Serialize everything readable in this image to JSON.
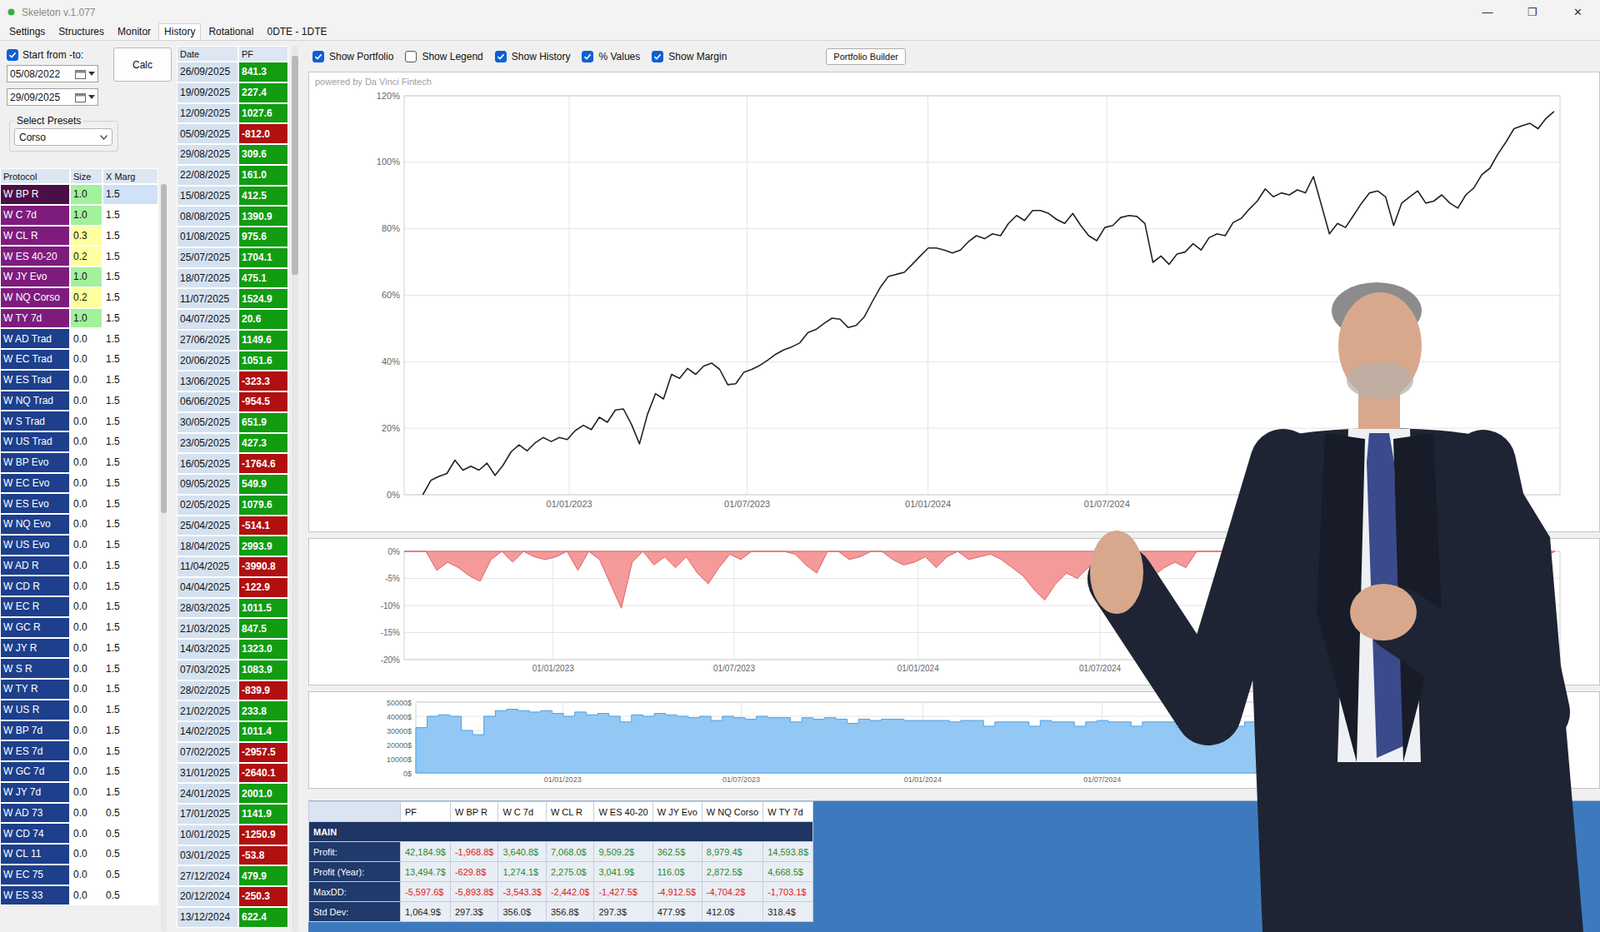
{
  "window": {
    "title": "Skeleton v.1.077",
    "controls": [
      "—",
      "❐",
      "✕"
    ]
  },
  "tabs": [
    {
      "label": "Settings",
      "selected": false
    },
    {
      "label": "Structures",
      "selected": false
    },
    {
      "label": "Monitor",
      "selected": false
    },
    {
      "label": "History",
      "selected": true
    },
    {
      "label": "Rotational",
      "selected": false
    },
    {
      "label": "0DTE - 1DTE",
      "selected": false
    }
  ],
  "range": {
    "checkbox": {
      "label": "Start from -to:",
      "checked": true
    },
    "from": "05/08/2022",
    "to": "29/09/2025",
    "calc": "Calc"
  },
  "presets": {
    "label": "Select Presets",
    "value": "Corso"
  },
  "protocols": {
    "columns": [
      "Protocol",
      "Size",
      "X Marg"
    ],
    "rows": [
      {
        "name": "W BP R",
        "size": "1.0",
        "margin": "1.5",
        "selected": true,
        "color": "#4b0f47",
        "size_color": "#a2f29c"
      },
      {
        "name": "W C 7d",
        "size": "1.0",
        "margin": "1.5",
        "selected": false,
        "color": "#7e1c7e",
        "size_color": "#a2f29c"
      },
      {
        "name": "W CL R",
        "size": "0.3",
        "margin": "1.5",
        "selected": false,
        "color": "#7e1c7e",
        "size_color": "#ffff9e"
      },
      {
        "name": "W ES 40-20",
        "size": "0.2",
        "margin": "1.5",
        "selected": false,
        "color": "#7e1c7e",
        "size_color": "#ffff9e"
      },
      {
        "name": "W JY Evo",
        "size": "1.0",
        "margin": "1.5",
        "selected": false,
        "color": "#7e1c7e",
        "size_color": "#a2f29c"
      },
      {
        "name": "W NQ Corso",
        "size": "0.2",
        "margin": "1.5",
        "selected": false,
        "color": "#7e1c7e",
        "size_color": "#ffff9e"
      },
      {
        "name": "W TY 7d",
        "size": "1.0",
        "margin": "1.5",
        "selected": false,
        "color": "#7e1c7e",
        "size_color": "#a2f29c"
      },
      {
        "name": "W AD Trad",
        "size": "0.0",
        "margin": "1.5",
        "selected": false,
        "color": "#1d3f8c",
        "size_color": "#ffffff"
      },
      {
        "name": "W EC Trad",
        "size": "0.0",
        "margin": "1.5",
        "selected": false,
        "color": "#1d3f8c",
        "size_color": "#ffffff"
      },
      {
        "name": "W ES Trad",
        "size": "0.0",
        "margin": "1.5",
        "selected": false,
        "color": "#1d3f8c",
        "size_color": "#ffffff"
      },
      {
        "name": "W NQ Trad",
        "size": "0.0",
        "margin": "1.5",
        "selected": false,
        "color": "#1d3f8c",
        "size_color": "#ffffff"
      },
      {
        "name": "W S Trad",
        "size": "0.0",
        "margin": "1.5",
        "selected": false,
        "color": "#1d3f8c",
        "size_color": "#ffffff"
      },
      {
        "name": "W US Trad",
        "size": "0.0",
        "margin": "1.5",
        "selected": false,
        "color": "#1d3f8c",
        "size_color": "#ffffff"
      },
      {
        "name": "W BP Evo",
        "size": "0.0",
        "margin": "1.5",
        "selected": false,
        "color": "#1d3f8c",
        "size_color": "#ffffff"
      },
      {
        "name": "W EC Evo",
        "size": "0.0",
        "margin": "1.5",
        "selected": false,
        "color": "#1d3f8c",
        "size_color": "#ffffff"
      },
      {
        "name": "W ES Evo",
        "size": "0.0",
        "margin": "1.5",
        "selected": false,
        "color": "#1d3f8c",
        "size_color": "#ffffff"
      },
      {
        "name": "W NQ Evo",
        "size": "0.0",
        "margin": "1.5",
        "selected": false,
        "color": "#1d3f8c",
        "size_color": "#ffffff"
      },
      {
        "name": "W US Evo",
        "size": "0.0",
        "margin": "1.5",
        "selected": false,
        "color": "#1d3f8c",
        "size_color": "#ffffff"
      },
      {
        "name": "W AD R",
        "size": "0.0",
        "margin": "1.5",
        "selected": false,
        "color": "#1d3f8c",
        "size_color": "#ffffff"
      },
      {
        "name": "W CD R",
        "size": "0.0",
        "margin": "1.5",
        "selected": false,
        "color": "#1d3f8c",
        "size_color": "#ffffff"
      },
      {
        "name": "W EC R",
        "size": "0.0",
        "margin": "1.5",
        "selected": false,
        "color": "#1d3f8c",
        "size_color": "#ffffff"
      },
      {
        "name": "W GC R",
        "size": "0.0",
        "margin": "1.5",
        "selected": false,
        "color": "#1d3f8c",
        "size_color": "#ffffff"
      },
      {
        "name": "W JY R",
        "size": "0.0",
        "margin": "1.5",
        "selected": false,
        "color": "#1d3f8c",
        "size_color": "#ffffff"
      },
      {
        "name": "W S R",
        "size": "0.0",
        "margin": "1.5",
        "selected": false,
        "color": "#1d3f8c",
        "size_color": "#ffffff"
      },
      {
        "name": "W TY R",
        "size": "0.0",
        "margin": "1.5",
        "selected": false,
        "color": "#1d3f8c",
        "size_color": "#ffffff"
      },
      {
        "name": "W US R",
        "size": "0.0",
        "margin": "1.5",
        "selected": false,
        "color": "#1d3f8c",
        "size_color": "#ffffff"
      },
      {
        "name": "W BP 7d",
        "size": "0.0",
        "margin": "1.5",
        "selected": false,
        "color": "#1d3f8c",
        "size_color": "#ffffff"
      },
      {
        "name": "W ES 7d",
        "size": "0.0",
        "margin": "1.5",
        "selected": false,
        "color": "#1d3f8c",
        "size_color": "#ffffff"
      },
      {
        "name": "W GC 7d",
        "size": "0.0",
        "margin": "1.5",
        "selected": false,
        "color": "#1d3f8c",
        "size_color": "#ffffff"
      },
      {
        "name": "W JY 7d",
        "size": "0.0",
        "margin": "1.5",
        "selected": false,
        "color": "#1d3f8c",
        "size_color": "#ffffff"
      },
      {
        "name": "W AD 73",
        "size": "0.0",
        "margin": "0.5",
        "selected": false,
        "color": "#1d3f8c",
        "size_color": "#ffffff"
      },
      {
        "name": "W CD 74",
        "size": "0.0",
        "margin": "0.5",
        "selected": false,
        "color": "#1d3f8c",
        "size_color": "#ffffff"
      },
      {
        "name": "W CL 11",
        "size": "0.0",
        "margin": "0.5",
        "selected": false,
        "color": "#1d3f8c",
        "size_color": "#ffffff"
      },
      {
        "name": "W EC 75",
        "size": "0.0",
        "margin": "0.5",
        "selected": false,
        "color": "#1d3f8c",
        "size_color": "#ffffff"
      },
      {
        "name": "W ES 33",
        "size": "0.0",
        "margin": "0.5",
        "selected": false,
        "color": "#1d3f8c",
        "size_color": "#ffffff"
      }
    ]
  },
  "history": {
    "columns": [
      "Date",
      "PF"
    ],
    "rows": [
      {
        "date": "26/09/2025",
        "pf": "841.3",
        "color": "#129c12"
      },
      {
        "date": "19/09/2025",
        "pf": "227.4",
        "color": "#129c12"
      },
      {
        "date": "12/09/2025",
        "pf": "1027.6",
        "color": "#129c12"
      },
      {
        "date": "05/09/2025",
        "pf": "-812.0",
        "color": "#b01010"
      },
      {
        "date": "29/08/2025",
        "pf": "309.6",
        "color": "#129c12"
      },
      {
        "date": "22/08/2025",
        "pf": "161.0",
        "color": "#129c12"
      },
      {
        "date": "15/08/2025",
        "pf": "412.5",
        "color": "#129c12"
      },
      {
        "date": "08/08/2025",
        "pf": "1390.9",
        "color": "#129c12"
      },
      {
        "date": "01/08/2025",
        "pf": "975.6",
        "color": "#129c12"
      },
      {
        "date": "25/07/2025",
        "pf": "1704.1",
        "color": "#129c12"
      },
      {
        "date": "18/07/2025",
        "pf": "475.1",
        "color": "#129c12"
      },
      {
        "date": "11/07/2025",
        "pf": "1524.9",
        "color": "#129c12"
      },
      {
        "date": "04/07/2025",
        "pf": "20.6",
        "color": "#129c12"
      },
      {
        "date": "27/06/2025",
        "pf": "1149.6",
        "color": "#129c12"
      },
      {
        "date": "20/06/2025",
        "pf": "1051.6",
        "color": "#129c12"
      },
      {
        "date": "13/06/2025",
        "pf": "-323.3",
        "color": "#b01010"
      },
      {
        "date": "06/06/2025",
        "pf": "-954.5",
        "color": "#b01010"
      },
      {
        "date": "30/05/2025",
        "pf": "651.9",
        "color": "#129c12"
      },
      {
        "date": "23/05/2025",
        "pf": "427.3",
        "color": "#129c12"
      },
      {
        "date": "16/05/2025",
        "pf": "-1764.6",
        "color": "#b01010"
      },
      {
        "date": "09/05/2025",
        "pf": "549.9",
        "color": "#129c12"
      },
      {
        "date": "02/05/2025",
        "pf": "1079.6",
        "color": "#129c12"
      },
      {
        "date": "25/04/2025",
        "pf": "-514.1",
        "color": "#b01010"
      },
      {
        "date": "18/04/2025",
        "pf": "2993.9",
        "color": "#129c12"
      },
      {
        "date": "11/04/2025",
        "pf": "-3990.8",
        "color": "#b01010"
      },
      {
        "date": "04/04/2025",
        "pf": "-122.9",
        "color": "#b01010"
      },
      {
        "date": "28/03/2025",
        "pf": "1011.5",
        "color": "#129c12"
      },
      {
        "date": "21/03/2025",
        "pf": "847.5",
        "color": "#129c12"
      },
      {
        "date": "14/03/2025",
        "pf": "1323.0",
        "color": "#129c12"
      },
      {
        "date": "07/03/2025",
        "pf": "1083.9",
        "color": "#129c12"
      },
      {
        "date": "28/02/2025",
        "pf": "-839.9",
        "color": "#b01010"
      },
      {
        "date": "21/02/2025",
        "pf": "233.8",
        "color": "#129c12"
      },
      {
        "date": "14/02/2025",
        "pf": "1011.4",
        "color": "#129c12"
      },
      {
        "date": "07/02/2025",
        "pf": "-2957.5",
        "color": "#b01010"
      },
      {
        "date": "31/01/2025",
        "pf": "-2640.1",
        "color": "#b01010"
      },
      {
        "date": "24/01/2025",
        "pf": "2001.0",
        "color": "#129c12"
      },
      {
        "date": "17/01/2025",
        "pf": "1141.9",
        "color": "#129c12"
      },
      {
        "date": "10/01/2025",
        "pf": "-1250.9",
        "color": "#b01010"
      },
      {
        "date": "03/01/2025",
        "pf": "-53.8",
        "color": "#b01010"
      },
      {
        "date": "27/12/2024",
        "pf": "479.9",
        "color": "#129c12"
      },
      {
        "date": "20/12/2024",
        "pf": "-250.3",
        "color": "#b01010"
      },
      {
        "date": "13/12/2024",
        "pf": "622.4",
        "color": "#129c12"
      }
    ]
  },
  "options": [
    {
      "label": "Show Portfolio",
      "checked": true
    },
    {
      "label": "Show Legend",
      "checked": false
    },
    {
      "label": "Show History",
      "checked": true
    },
    {
      "label": "% Values",
      "checked": true
    },
    {
      "label": "Show Margin",
      "checked": true
    }
  ],
  "builder_button": "Portfolio Builder",
  "equity_chart": {
    "watermark": "powered by Da Vinci Fintech",
    "y_ticks": [
      "120%",
      "100%",
      "80%",
      "60%",
      "40%",
      "20%",
      "0%"
    ],
    "x_ticks": [
      "01/01/2023",
      "01/07/2023",
      "01/01/2024",
      "01/07/2024"
    ],
    "values": [
      0,
      4.3,
      5.5,
      6.4,
      10.4,
      7.4,
      8.6,
      7.4,
      9.5,
      5.8,
      8.9,
      12.9,
      15,
      13.2,
      15.6,
      17.2,
      16,
      17.2,
      16.6,
      19.3,
      20.9,
      19.6,
      23.3,
      21.8,
      25.5,
      25.8,
      21.2,
      15.3,
      24.2,
      30.4,
      28.8,
      36.2,
      35,
      38,
      36.2,
      38.7,
      39.6,
      37.7,
      33.1,
      33.4,
      36.8,
      37.7,
      38.9,
      40.5,
      42.3,
      43.6,
      44.5,
      45.7,
      48.8,
      49.7,
      51.5,
      53.1,
      52.8,
      50.3,
      50.9,
      53.4,
      58,
      62.3,
      65.6,
      66.3,
      66.9,
      69.3,
      71.8,
      74.2,
      74.2,
      73.6,
      72.7,
      73.6,
      76.1,
      77.9,
      77,
      78.5,
      77.9,
      81.6,
      84,
      82.5,
      85.5,
      85.5,
      84.6,
      82.8,
      81.6,
      84.6,
      81,
      77.9,
      76.4,
      80.4,
      81,
      83.4,
      84,
      83.7,
      81.6,
      69.9,
      71.8,
      69.3,
      72.4,
      73,
      75.5,
      73.6,
      77.3,
      78.5,
      77.9,
      81.9,
      83.1,
      85.9,
      88.3,
      92,
      89.6,
      90.8,
      90.2,
      91.7,
      90.8,
      95.7,
      87.1,
      78.5,
      81.6,
      80.4,
      84,
      87.7,
      90.8,
      91.4,
      89.6,
      81,
      87.7,
      89.6,
      91.4,
      87.7,
      88.3,
      90.2,
      87.7,
      86.2,
      90.2,
      92.3,
      96.3,
      98.2,
      102.5,
      106.1,
      110.1,
      111,
      111.7,
      110.1,
      113.2,
      115.3
    ]
  },
  "drawdown_chart": {
    "y_ticks": [
      "0%",
      "-5%",
      "-10%",
      "-15%",
      "-20%"
    ],
    "x_ticks": [
      "01/01/2023",
      "01/07/2023",
      "01/01/2024",
      "01/07/2024"
    ],
    "values": [
      0,
      0,
      0,
      -3.5,
      -2,
      -3,
      -4.5,
      -5.5,
      -1.5,
      0,
      -2,
      0,
      -1,
      -1.5,
      -1,
      0,
      -3.5,
      0,
      -1.5,
      -6,
      -10.5,
      -2,
      0,
      -2.5,
      -1,
      -3,
      -1,
      -4,
      -6,
      -3,
      -0.5,
      -1.5,
      0,
      0,
      0,
      0,
      -0.5,
      -2.5,
      -4,
      0,
      0,
      -1.5,
      -1,
      0,
      0,
      -1.5,
      -2.5,
      -2,
      -1,
      -3,
      -1,
      0,
      -1.5,
      -1,
      -0.5,
      -1.5,
      -3,
      -4.5,
      -7,
      -9,
      -6,
      -4,
      -5,
      -3,
      -2,
      -7,
      -6,
      -5,
      -4,
      -4.5,
      -3,
      -2,
      -3,
      0,
      0,
      0,
      0,
      -1,
      0,
      0,
      -1.5,
      0,
      -1,
      0,
      -2,
      -7,
      -8,
      -6,
      -5,
      -3,
      -1,
      0,
      -6,
      -2,
      0,
      0,
      -1,
      0,
      -1.5,
      -1,
      0,
      0,
      0,
      0,
      0,
      -1,
      0
    ]
  },
  "margin_chart": {
    "y_ticks": [
      "50000$",
      "40000$",
      "30000$",
      "20000$",
      "10000$",
      "0$"
    ],
    "x_ticks": [
      "01/01/2023",
      "01/07/2023",
      "01/01/2024",
      "01/07/2024"
    ],
    "values": [
      32000,
      40000,
      41000,
      40000,
      30000,
      27000,
      40000,
      44000,
      45000,
      44000,
      43000,
      44000,
      42000,
      40000,
      43000,
      41000,
      42000,
      40000,
      36000,
      41000,
      40000,
      42000,
      41000,
      40000,
      39000,
      40000,
      37000,
      40000,
      39000,
      38000,
      40000,
      39000,
      39000,
      36000,
      39000,
      38000,
      39000,
      38000,
      35000,
      38000,
      37000,
      38000,
      38000,
      37000,
      37000,
      37000,
      37000,
      36000,
      37000,
      37000,
      33000,
      36000,
      36000,
      36000,
      33000,
      37000,
      36000,
      36000,
      33000,
      36000,
      37000,
      36000,
      36000,
      33000,
      36000,
      36000,
      36000,
      32000,
      36000,
      36000,
      36000,
      36000,
      33000,
      36000,
      36000,
      36000,
      36000,
      32000,
      36000,
      36000,
      36000,
      36000,
      36000,
      33000,
      36000,
      36000,
      36000,
      36000,
      33000,
      36000,
      36000,
      36000,
      36000,
      36000,
      36000,
      33000,
      36000,
      36000,
      36000,
      36000
    ]
  },
  "stats": {
    "columns": [
      "PF",
      "W BP R",
      "W C 7d",
      "W CL R",
      "W ES 40-20",
      "W JY Evo",
      "W NQ Corso",
      "W TY 7d"
    ],
    "section": "MAIN",
    "rows": [
      {
        "label": "Profit:",
        "cells": [
          {
            "text": "42,184.9$",
            "color": "#2a8a2a"
          },
          {
            "text": "-1,968.8$",
            "color": "#e02020"
          },
          {
            "text": "3,640.8$",
            "color": "#2a8a2a"
          },
          {
            "text": "7,068.0$",
            "color": "#2a8a2a"
          },
          {
            "text": "9,509.2$",
            "color": "#2a8a2a"
          },
          {
            "text": "362.5$",
            "color": "#2a8a2a"
          },
          {
            "text": "8,979.4$",
            "color": "#2a8a2a"
          },
          {
            "text": "14,593.8$",
            "color": "#2a8a2a"
          }
        ]
      },
      {
        "label": "Profit (Year):",
        "cells": [
          {
            "text": "13,494.7$",
            "color": "#2a8a2a"
          },
          {
            "text": "-629.8$",
            "color": "#e02020"
          },
          {
            "text": "1,274.1$",
            "color": "#2a8a2a"
          },
          {
            "text": "2,275.0$",
            "color": "#2a8a2a"
          },
          {
            "text": "3,041.9$",
            "color": "#2a8a2a"
          },
          {
            "text": "116.0$",
            "color": "#2a8a2a"
          },
          {
            "text": "2,872.5$",
            "color": "#2a8a2a"
          },
          {
            "text": "4,668.5$",
            "color": "#2a8a2a"
          }
        ]
      },
      {
        "label": "MaxDD:",
        "cells": [
          {
            "text": "-5,597.6$",
            "color": "#e02020"
          },
          {
            "text": "-5,893.8$",
            "color": "#e02020"
          },
          {
            "text": "-3,543.3$",
            "color": "#e02020"
          },
          {
            "text": "-2,442.0$",
            "color": "#e02020"
          },
          {
            "text": "-1,427.5$",
            "color": "#e02020"
          },
          {
            "text": "-4,912.5$",
            "color": "#e02020"
          },
          {
            "text": "-4,704.2$",
            "color": "#e02020"
          },
          {
            "text": "-1,703.1$",
            "color": "#e02020"
          }
        ]
      },
      {
        "label": "Std Dev:",
        "cells": [
          {
            "text": "1,064.9$",
            "color": "#222222"
          },
          {
            "text": "297.3$",
            "color": "#222222"
          },
          {
            "text": "356.0$",
            "color": "#222222"
          },
          {
            "text": "356.8$",
            "color": "#222222"
          },
          {
            "text": "297.3$",
            "color": "#222222"
          },
          {
            "text": "477.9$",
            "color": "#222222"
          },
          {
            "text": "412.0$",
            "color": "#222222"
          },
          {
            "text": "318.4$",
            "color": "#222222"
          }
        ]
      }
    ]
  }
}
